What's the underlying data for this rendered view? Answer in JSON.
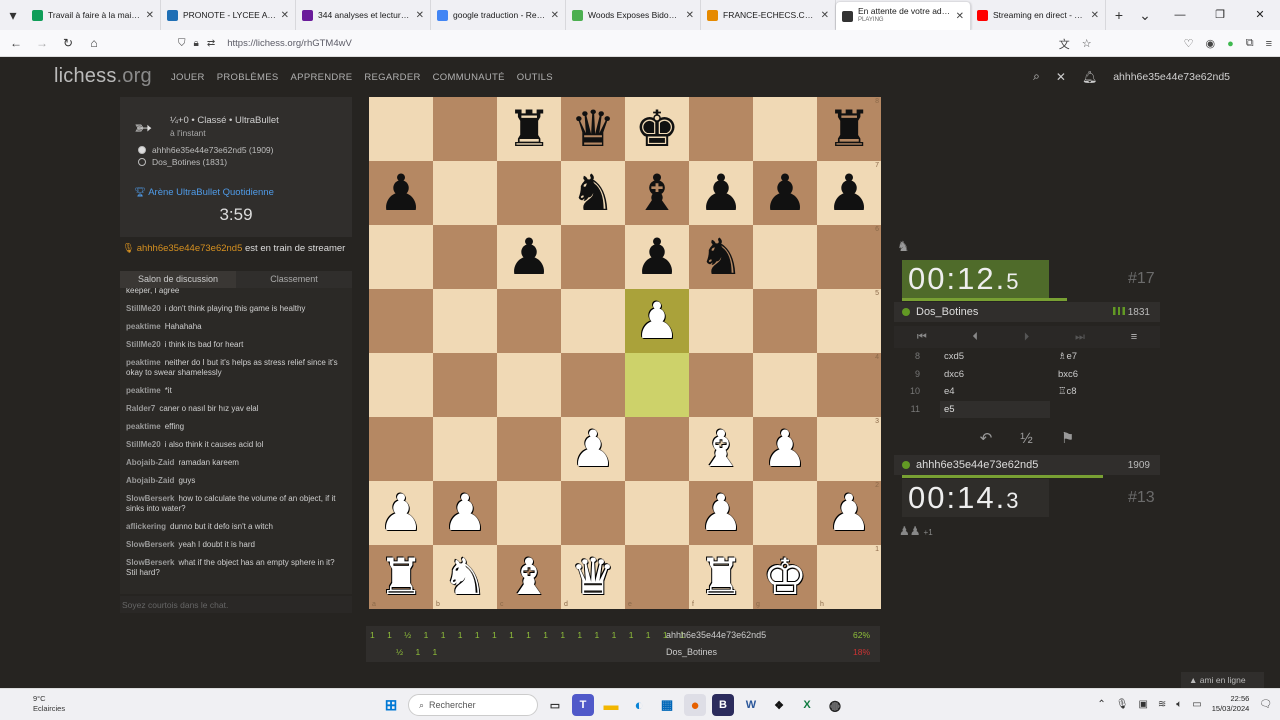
{
  "browser": {
    "tabs": [
      {
        "title": "Travail à faire à la maison -",
        "color": "#0f9d58"
      },
      {
        "title": "PRONOTE - LYCEE ANTONIN AR",
        "color": "#1f6fb5"
      },
      {
        "title": "344 analyses et lectures line",
        "color": "#6a1b9a"
      },
      {
        "title": "google traduction - Recher",
        "color": "#4285f4"
      },
      {
        "title": "Woods Exposes Bidonville",
        "color": "#4caf50"
      },
      {
        "title": "FRANCE-ECHECS.COM -",
        "color": "#e68a00"
      },
      {
        "title": "En attente de votre adversa",
        "subtitle": "PLAYING",
        "color": "#333333"
      },
      {
        "title": "Streaming en direct - YouTu",
        "color": "#ff0000"
      }
    ],
    "url": "https://lichess.org/rhGTM4wV"
  },
  "site": {
    "logo_main": "lichess",
    "logo_tld": ".org",
    "menu": [
      "JOUER",
      "PROBLÈMES",
      "APPRENDRE",
      "REGARDER",
      "COMMUNAUTÉ",
      "OUTILS"
    ],
    "username": "ahhh6e35e44e73e62nd5"
  },
  "game_info": {
    "title": "¼+0 • Classé • UltraBullet",
    "time": "à l'instant",
    "white": "ahhh6e35e44e73e62nd5 (1909)",
    "black": "Dos_Botines (1831)",
    "arena": "Arène UltraBullet Quotidienne",
    "arena_clock": "3:59"
  },
  "streamer": {
    "name": "ahhh6e35e44e73e62nd5",
    "text": " est en train de streamer"
  },
  "chat": {
    "tab_chat": "Salon de discussion",
    "tab_ranking": "Classement",
    "placeholder": "Soyez courtois dans le chat.",
    "messages": [
      {
        "user": "",
        "text": "keeper, I agree"
      },
      {
        "user": "StillMe20",
        "text": "i don't think playing this game is healthy"
      },
      {
        "user": "peaktime",
        "text": "Hahahaha"
      },
      {
        "user": "StillMe20",
        "text": "i think its bad for heart"
      },
      {
        "user": "peaktime",
        "text": "neither do I but it's helps as stress relief since it's okay to swear shamelessly"
      },
      {
        "user": "peaktime",
        "text": "*it"
      },
      {
        "user": "Ralder7",
        "text": "caner o nasıl bir hız yav elal"
      },
      {
        "user": "peaktime",
        "text": "effing"
      },
      {
        "user": "StillMe20",
        "text": "i also think it causes acid lol"
      },
      {
        "user": "Abojaib-Zaid",
        "text": "ramadan kareem"
      },
      {
        "user": "Abojaib-Zaid",
        "text": "guys"
      },
      {
        "user": "SlowBerserk",
        "text": "how to calculate the volume of an object, if it sinks into water?"
      },
      {
        "user": "aflickering",
        "text": "dunno but it defo isn't a witch"
      },
      {
        "user": "SlowBerserk",
        "text": "yeah I doubt it is hard"
      },
      {
        "user": "SlowBerserk",
        "text": "what if the object has an empty sphere in it? Stil hard?"
      }
    ]
  },
  "board": {
    "ranks": [
      "8",
      "7",
      "6",
      "5",
      "4",
      "3",
      "2",
      "1"
    ],
    "files": [
      "a",
      "b",
      "c",
      "d",
      "e",
      "f",
      "g",
      "h"
    ],
    "position": [
      [
        "",
        "",
        "bR",
        "bQ",
        "bK",
        "",
        "",
        "bR"
      ],
      [
        "bP",
        "",
        "",
        "bN",
        "bB",
        "bP",
        "bP",
        "bP"
      ],
      [
        "",
        "",
        "bP",
        "",
        "bP",
        "bN",
        "",
        ""
      ],
      [
        "",
        "",
        "",
        "",
        "wP",
        "",
        "",
        ""
      ],
      [
        "",
        "",
        "",
        "",
        "",
        "",
        "",
        ""
      ],
      [
        "",
        "",
        "",
        "wP",
        "",
        "wB",
        "wP",
        ""
      ],
      [
        "wP",
        "wP",
        "",
        "",
        "",
        "wP",
        "",
        "wP"
      ],
      [
        "wR",
        "wN",
        "wB",
        "wQ",
        "",
        "wR",
        "wK",
        ""
      ]
    ],
    "last_move": [
      "e4",
      "e5"
    ]
  },
  "opponent": {
    "name": "Dos_Botines",
    "rating": "1831",
    "clock_main": "00:12",
    "clock_tenth": "5",
    "move_label": "#17",
    "time_fraction": 0.78
  },
  "me": {
    "name": "ahhh6e35e44e73e62nd5",
    "rating": "1909",
    "clock_main": "00:14",
    "clock_tenth": "3",
    "move_label": "#13",
    "time_fraction": 0.95,
    "captured_extra": "+1"
  },
  "moves": [
    {
      "n": "8",
      "white": "cxd5",
      "black": "♗e7"
    },
    {
      "n": "9",
      "white": "dxc6",
      "black": "bxc6"
    },
    {
      "n": "10",
      "white": "e4",
      "black": "♖c8"
    },
    {
      "n": "11",
      "white": "e5",
      "black": ""
    }
  ],
  "tournament_scores": {
    "white_points": "1 1 ½   1 1   1 1 1 1 1 1 1 1 1 1 1 1 1 1",
    "black_points": "½ 1     1",
    "white_name": "ahhh6e35e44e73e62nd5",
    "black_name": "Dos_Botines",
    "white_pct": "62%",
    "black_pct": "18%"
  },
  "friends_label": "ami en ligne",
  "taskbar": {
    "temp": "9°C",
    "weather": "Eclaircies",
    "search": "Rechercher",
    "time": "22:56",
    "date": "15/03/2024"
  }
}
